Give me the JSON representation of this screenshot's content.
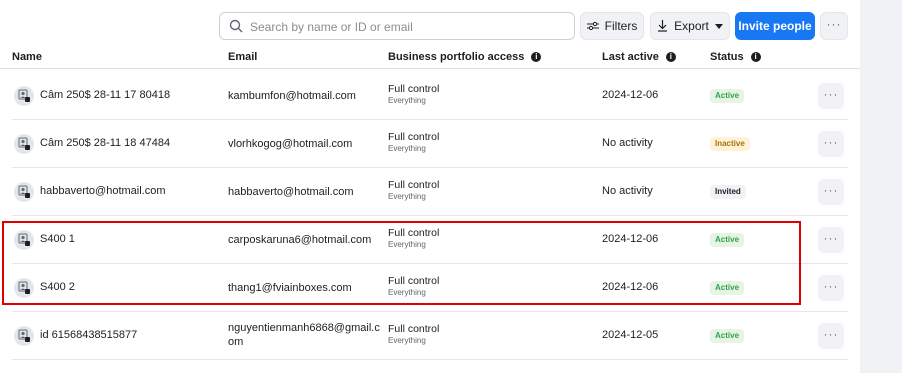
{
  "toolbar": {
    "search_placeholder": "Search by name or ID or email",
    "filters_label": "Filters",
    "export_label": "Export",
    "invite_label": "Invite people",
    "more_label": "···"
  },
  "columns": {
    "name": "Name",
    "email": "Email",
    "access": "Business portfolio access",
    "last_active": "Last active",
    "status": "Status"
  },
  "rows": [
    {
      "name": "Câm 250$ 28-11 17 80418",
      "email": "kambumfon@hotmail.com",
      "access": "Full control",
      "access_sub": "Everything",
      "last_active": "2024-12-06",
      "status": "Active",
      "status_kind": "active"
    },
    {
      "name": "Câm 250$ 28-11 18 47484",
      "email": "vlorhkogog@hotmail.com",
      "access": "Full control",
      "access_sub": "Everything",
      "last_active": "No activity",
      "status": "Inactive",
      "status_kind": "inactive"
    },
    {
      "name": "habbaverto@hotmail.com",
      "email": "habbaverto@hotmail.com",
      "access": "Full control",
      "access_sub": "Everything",
      "last_active": "No activity",
      "status": "Invited",
      "status_kind": "invited"
    },
    {
      "name": "S400 1",
      "email": "carposkaruna6@hotmail.com",
      "access": "Full control",
      "access_sub": "Everything",
      "last_active": "2024-12-06",
      "status": "Active",
      "status_kind": "active"
    },
    {
      "name": "S400 2",
      "email": "thang1@fviainboxes.com",
      "access": "Full control",
      "access_sub": "Everything",
      "last_active": "2024-12-06",
      "status": "Active",
      "status_kind": "active"
    },
    {
      "name": "id 61568438515877",
      "email": "nguyentienmanh6868@gmail.c om",
      "access": "Full control",
      "access_sub": "Everything",
      "last_active": "2024-12-05",
      "status": "Active",
      "status_kind": "active"
    }
  ],
  "row_more_label": "···",
  "icons": {
    "search": "search-icon",
    "filters": "sliders-icon",
    "export": "download-icon",
    "info": "info-icon",
    "avatar": "user-shield-icon"
  },
  "colors": {
    "accent": "#1877f2",
    "active": "#31a24c",
    "inactive": "#a4730a",
    "highlight": "#e00000"
  }
}
